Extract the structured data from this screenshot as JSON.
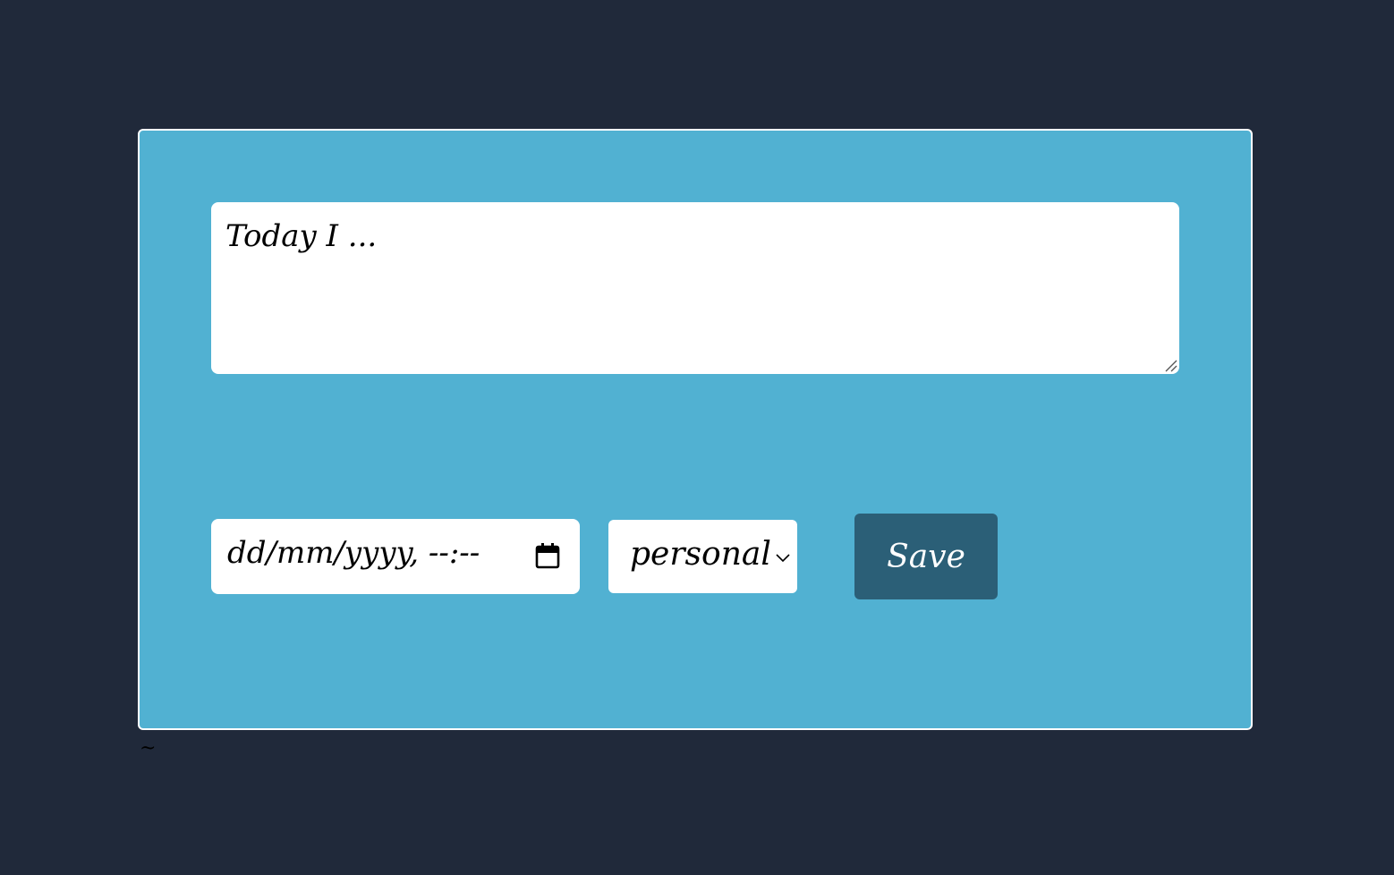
{
  "form": {
    "entry_placeholder": "Today I ...",
    "date_placeholder": "dd/mm/yyyy, --:--",
    "category_value": "personal",
    "save_label": "Save"
  },
  "footer": {
    "mark": "~"
  },
  "colors": {
    "page_background": "#20293a",
    "panel_background": "#51b1d2",
    "panel_border": "#ffffff",
    "button_background": "#2b5f77",
    "button_text": "#ffffff"
  },
  "icons": {
    "date_picker": "calendar-icon",
    "select": "chevron-down-icon",
    "textarea": "resize-handle-icon"
  }
}
